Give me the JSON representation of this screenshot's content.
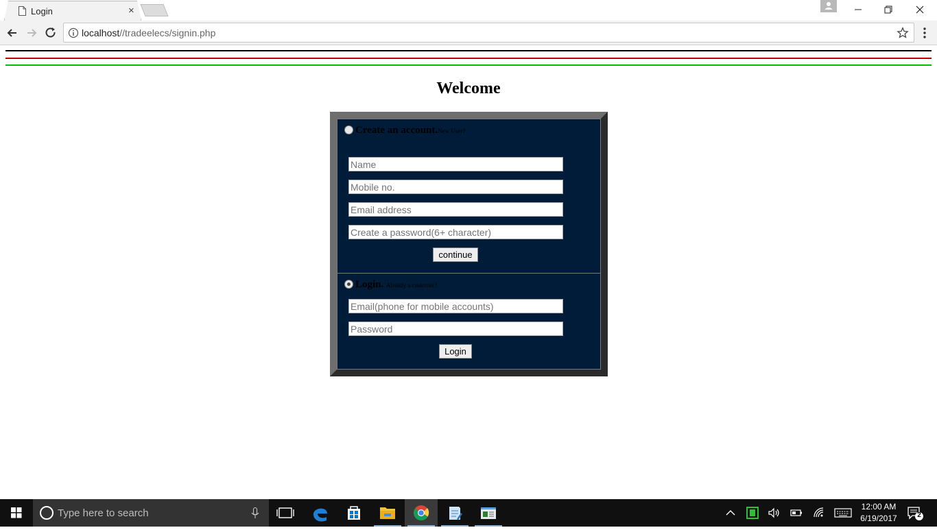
{
  "browser": {
    "tab_title": "Login",
    "tab_close": "×",
    "url_host": "localhost",
    "url_path": "//tradeelecs/signin.php"
  },
  "page": {
    "heading": "Welcome",
    "create_section": {
      "title": "Create an account.",
      "subtitle": "New User?",
      "radio_checked": false,
      "fields": {
        "name_placeholder": "Name",
        "mobile_placeholder": "Mobile no.",
        "email_placeholder": "Email address",
        "password_placeholder": "Create a password(6+ character)"
      },
      "submit_label": "continue"
    },
    "login_section": {
      "title": "Login.",
      "subtitle": "Already a customer?",
      "radio_checked": true,
      "fields": {
        "email_placeholder": "Email(phone for mobile accounts)",
        "password_placeholder": "Password"
      },
      "submit_label": "Login"
    },
    "colors": {
      "form_bg": "#001c38",
      "rule_black": "#000000",
      "rule_red": "#c00000",
      "rule_green": "#00c000"
    }
  },
  "taskbar": {
    "search_placeholder": "Type here to search",
    "time": "12:00 AM",
    "date": "6/19/2017",
    "notification_count": "2",
    "pinned_apps": [
      "task-view-icon",
      "edge-icon",
      "store-icon",
      "file-explorer-icon",
      "chrome-icon",
      "notepad-icon",
      "app-icon"
    ]
  }
}
